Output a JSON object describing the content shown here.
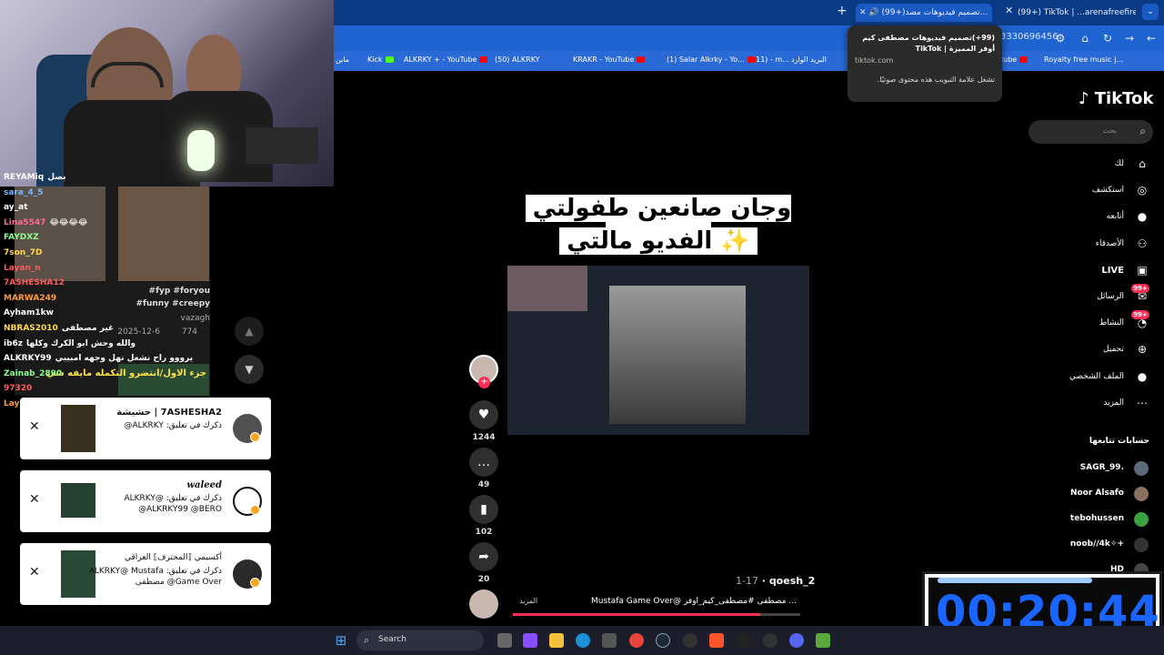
{
  "browser": {
    "tabs": [
      {
        "label": "(99+)تصميم فيديوهات مصد...",
        "active": true
      },
      {
        "label": "(99+) TikTok | ...arenafreefirelat",
        "active": false
      }
    ],
    "address_fragment": "3330696456",
    "bookmarks": [
      "Royalty free music |...",
      "tube",
      "البريد الوارد",
      "(11) - m...",
      "(1) Salar Alkrky - Yo...",
      "KRAKR - YouTube",
      "(50) ALKRKY",
      "ALKRKY + - YouTube",
      "Kick",
      "ماين"
    ]
  },
  "tooltip": {
    "title": "(99+)تصميم فيديوهات مصطفى كيم أوفر المميزة | TikTok",
    "domain": "tiktok.com",
    "note": "تشغل علامة التبويب هذه محتوى صوتيًا."
  },
  "chat": {
    "lines": [
      {
        "user": "REYAMiq",
        "text": "بصل",
        "color": "#ffffff"
      },
      {
        "user": "sara_4_5",
        "text": "",
        "color": "#7ab8ff"
      },
      {
        "user": "ay_at",
        "text": "",
        "color": "#ffffff"
      },
      {
        "user": "Lina5547",
        "text": "😂😂😂😂",
        "color": "#ff6b9a"
      },
      {
        "user": "FAYDXZ",
        "text": "",
        "color": "#8cff8c"
      },
      {
        "user": "7son_7D",
        "text": "",
        "color": "#ffd84a"
      },
      {
        "user": "Layan_n",
        "text": "",
        "color": "#ff5a5a"
      },
      {
        "user": "7ASHESHA12",
        "text": "",
        "color": "#ff5a5a"
      },
      {
        "user": "MARWA249",
        "text": "",
        "color": "#ff9a3a"
      },
      {
        "user": "Ayham1kw",
        "text": "",
        "color": "#ffffff"
      },
      {
        "user": "NBRAS2010",
        "text": "غير مصطفى",
        "color": "#ffd84a"
      },
      {
        "user": "ib6z",
        "text": "والله وحش ابو الكرك وكلها",
        "color": "#ffffff"
      },
      {
        "user": "ALKRKY99",
        "text": "يرووو راح نشغل نهل وجهه امبيبي",
        "color": "#ffffff"
      },
      {
        "user": "Zainab_2890",
        "text": "",
        "color": "#8cff8c"
      },
      {
        "user": "97320",
        "text": "",
        "color": "#ff5a5a"
      },
      {
        "user": "Layla_lolo",
        "text": "ان شاء ح",
        "color": "#ff9a3a"
      }
    ],
    "side_video": {
      "hashtags": "fyp #foryou#",
      "hashtags2": "funny #creepy#",
      "author": "vazagh",
      "date": "2025-12-6",
      "likes": "774",
      "caption": "جزء الاول/انتضرو التكمله مايفه شي"
    }
  },
  "notifications": [
    {
      "name": "7ASHESHA2 | حشيشة",
      "body": "ذكرك في تعليق: ALKRKY@"
    },
    {
      "name": "waleed",
      "body": "ذكرك في تعليق: ALKRKY@ ALKRKY99 @BERO@"
    },
    {
      "name": "أكسيمي ⟦المحترف⟧ العراقي",
      "body": "ذكرك في تعليق: ALKRKY@ Mustafa Game Over@ مصطفى"
    }
  ],
  "video": {
    "caption_line1": "وجان صانعين طفولتي يشوفون",
    "caption_line2": "الفديو مالتي ✨",
    "author": "qoesh_2",
    "date": "1-17",
    "description": "Mustafa Game Over@ مصطفى #مصطفى_كيم_اوفر ...",
    "more_label": "المزيد",
    "progress": 0.86,
    "likes": "1244",
    "comments": "49",
    "saves": "102",
    "shares": "20"
  },
  "tiktok": {
    "logo": "TikTok",
    "search_placeholder": "بحث",
    "nav": [
      {
        "label": "لك",
        "icon": "home-icon"
      },
      {
        "label": "استكشف",
        "icon": "compass-icon"
      },
      {
        "label": "أتابعه",
        "icon": "following-icon"
      },
      {
        "label": "الأصدقاء",
        "icon": "friends-icon"
      },
      {
        "label": "LIVE",
        "icon": "live-icon"
      },
      {
        "label": "الرسائل",
        "icon": "messages-icon",
        "badge": "99+"
      },
      {
        "label": "النشاط",
        "icon": "activity-icon",
        "badge": "99+"
      },
      {
        "label": "تحميل",
        "icon": "upload-icon"
      },
      {
        "label": "الملف الشخصي",
        "icon": "profile-icon"
      },
      {
        "label": "المزيد",
        "icon": "more-icon"
      }
    ],
    "following_header": "حسابات تتابعها",
    "following": [
      "SAGR_99.",
      "Noor Alsafo",
      "tebohussen",
      "noob//4k✧+",
      "HD"
    ]
  },
  "timer": {
    "value": "00:20:44"
  },
  "taskbar": {
    "search_label": "Search"
  }
}
